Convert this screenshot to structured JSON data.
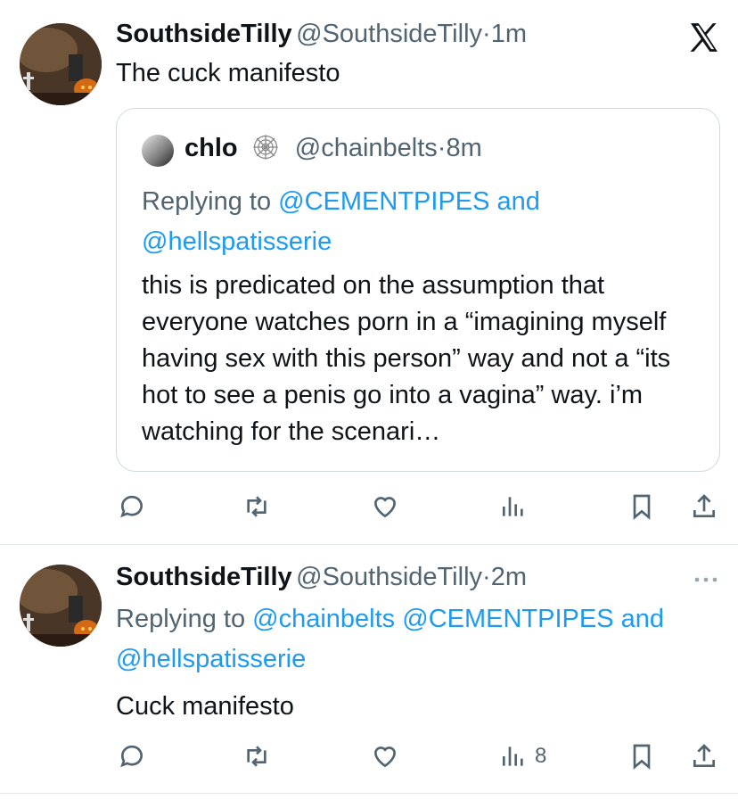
{
  "tweet1": {
    "name": "SouthsideTilly",
    "handle": "@SouthsideTilly",
    "sep": "·",
    "time": "1m",
    "text": "The cuck manifesto",
    "quote": {
      "name": "chlo",
      "handle": "@chainbelts",
      "sep": "·",
      "time": "8m",
      "replying_prefix": "Replying to ",
      "replying_link1": "@CEMENTPIPES",
      "replying_and": " and",
      "replying_link2": "@hellspatisserie",
      "text": "this is predicated on the assumption that everyone watches porn in a “imagining myself having sex with this person” way and not a “its hot to see a penis go into a vagina” way. i’m watching for the scenari…"
    }
  },
  "tweet2": {
    "name": "SouthsideTilly",
    "handle": "@SouthsideTilly",
    "sep": "·",
    "time": "2m",
    "replying_prefix": "Replying to ",
    "replying_link1": "@chainbelts",
    "replying_link2": "@CEMENTPIPES",
    "replying_and": " and",
    "replying_link3": "@hellspatisserie",
    "text": "Cuck manifesto",
    "views": "8"
  },
  "colors": {
    "link": "#1d9bf0",
    "muted": "#536471",
    "text": "#0f1419"
  },
  "icons": [
    "x-logo",
    "reply-icon",
    "retweet-icon",
    "like-icon",
    "views-icon",
    "bookmark-icon",
    "share-icon",
    "more-icon"
  ]
}
